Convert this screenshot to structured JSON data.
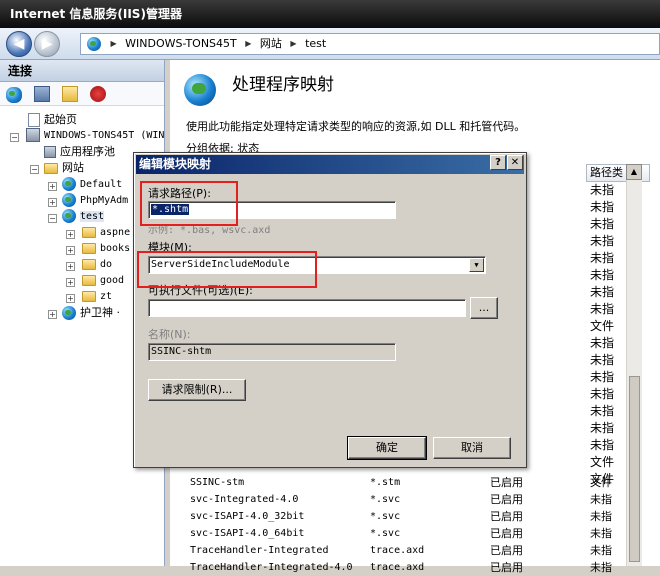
{
  "window": {
    "title": "Internet 信息服务(IIS)管理器"
  },
  "address": {
    "segments": [
      "WINDOWS-TONS45T",
      "网站",
      "test"
    ]
  },
  "connections": {
    "header": "连接",
    "tree": [
      {
        "label": "起始页"
      },
      {
        "label": "WINDOWS-TONS45T (WIN"
      },
      {
        "label": "应用程序池"
      },
      {
        "label": "网站"
      },
      {
        "label": "Default"
      },
      {
        "label": "PhpMyAdm"
      },
      {
        "label": "test"
      },
      {
        "label": "aspne"
      },
      {
        "label": "books"
      },
      {
        "label": "do"
      },
      {
        "label": "good"
      },
      {
        "label": "zt"
      },
      {
        "label": "护卫神 ·"
      }
    ]
  },
  "main": {
    "title": "处理程序映射",
    "description": "使用此功能指定处理特定请求类型的响应的资源,如 DLL 和托管代码。",
    "group_by": "分组依据: 状态",
    "col_path_type": "路径类",
    "right_col": [
      "未指",
      "未指",
      "未指",
      "未指",
      "未指",
      "未指",
      "未指",
      "未指",
      "文件",
      "未指",
      "未指",
      "未指",
      "未指",
      "未指",
      "未指",
      "未指",
      "文件",
      "文件"
    ],
    "rows": [
      {
        "name": "SSINC-stm",
        "path": "*.stm",
        "state": "已启用",
        "type": "文件"
      },
      {
        "name": "svc-Integrated-4.0",
        "path": "*.svc",
        "state": "已启用",
        "type": "未指"
      },
      {
        "name": "svc-ISAPI-4.0_32bit",
        "path": "*.svc",
        "state": "已启用",
        "type": "未指"
      },
      {
        "name": "svc-ISAPI-4.0_64bit",
        "path": "*.svc",
        "state": "已启用",
        "type": "未指"
      },
      {
        "name": "TraceHandler-Integrated",
        "path": "trace.axd",
        "state": "已启用",
        "type": "未指"
      },
      {
        "name": "TraceHandler-Integrated-4.0",
        "path": "trace.axd",
        "state": "已启用",
        "type": "未指"
      }
    ]
  },
  "dialog": {
    "title": "编辑模块映射",
    "help": "?",
    "close": "✕",
    "request_path_label": "请求路径(P):",
    "request_path_value": "*.shtm",
    "example": "示例: *.bas, wsvc.axd",
    "module_label": "模块(M):",
    "module_value": "ServerSideIncludeModule",
    "executable_label": "可执行文件(可选)(E):",
    "executable_value": "",
    "browse": "...",
    "name_label": "名称(N):",
    "name_value": "SSINC-shtm",
    "restrictions": "请求限制(R)...",
    "ok": "确定",
    "cancel": "取消"
  }
}
